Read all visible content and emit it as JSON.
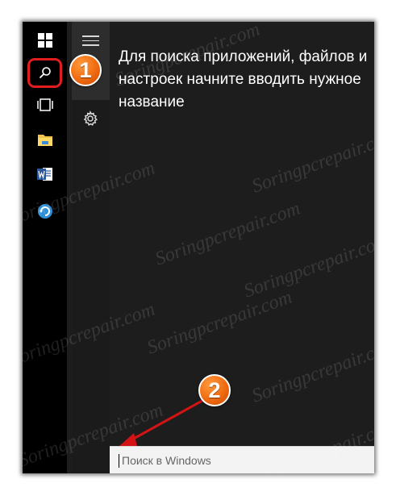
{
  "start_menu": {
    "hint_text": "Для поиска приложений, файлов и настроек начните вводить нужное название",
    "search_placeholder": "Поиск в Windows"
  },
  "taskbar": {
    "icons": [
      "windows-logo-icon",
      "search-icon",
      "task-view-icon",
      "file-explorer-icon",
      "word-icon",
      "sync-app-icon"
    ]
  },
  "rail": {
    "icons": [
      "hamburger-menu-icon",
      "settings-gear-icon"
    ]
  },
  "annotations": {
    "step1": "1",
    "step2": "2",
    "highlight_color": "#e21d1d",
    "arrow_color": "#d41414"
  },
  "watermark": {
    "text": "Soringpcrepair.com"
  },
  "colors": {
    "taskbar": "#000000",
    "start_bg": "#1d1d1d",
    "rail_top": "#2d2d2d",
    "badge_orange": "#f06a10"
  }
}
